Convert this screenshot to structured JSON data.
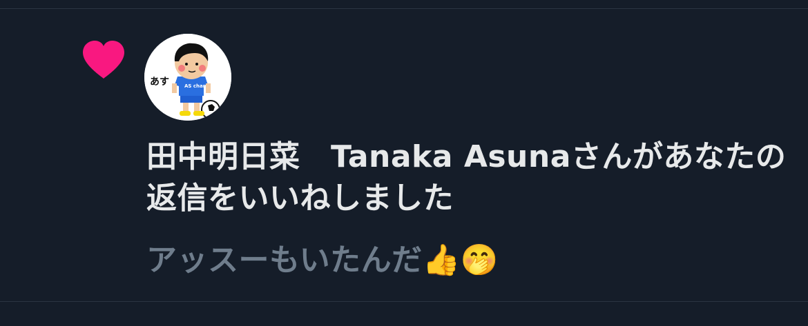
{
  "notification": {
    "type_icon": "heart-icon",
    "accent_color": "#f91880",
    "avatar": {
      "label": "あす",
      "shirt_text": "AS channel"
    },
    "user_name": "田中明日菜　Tanaka Asuna",
    "action_text": "さんがあなたの返信をいいねしました",
    "reply_text": "アッスーもいたんだ👍🤭"
  }
}
